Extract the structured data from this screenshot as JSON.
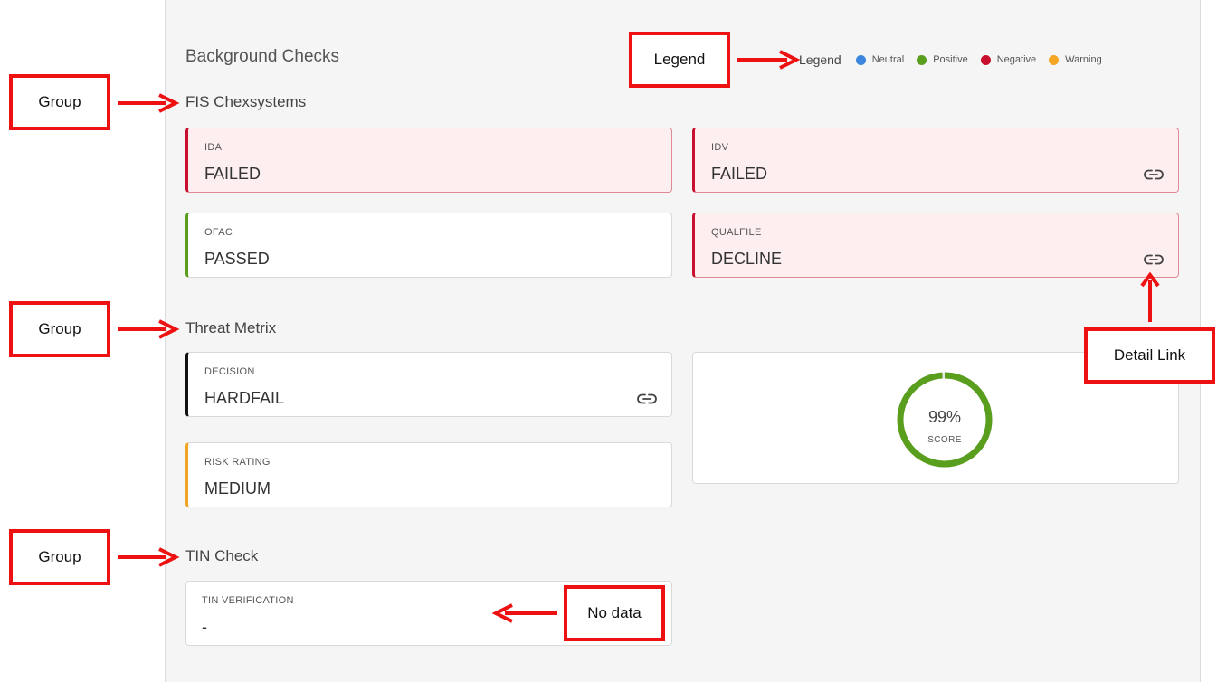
{
  "section": {
    "title": "Background Checks"
  },
  "legend": {
    "label": "Legend",
    "items": [
      {
        "label": "Neutral",
        "color": "#3d86e0"
      },
      {
        "label": "Positive",
        "color": "#5a9e1e"
      },
      {
        "label": "Negative",
        "color": "#c8102e"
      },
      {
        "label": "Warning",
        "color": "#f5a623"
      }
    ]
  },
  "groups": {
    "fis": {
      "title": "FIS Chexsystems",
      "ida": {
        "label": "IDA",
        "value": "FAILED",
        "status": "negative"
      },
      "idv": {
        "label": "IDV",
        "value": "FAILED",
        "status": "negative",
        "icon": "link-icon"
      },
      "ofac": {
        "label": "OFAC",
        "value": "PASSED",
        "status": "positive"
      },
      "qualfile": {
        "label": "QUALFILE",
        "value": "DECLINE",
        "status": "negative",
        "icon": "link-icon"
      }
    },
    "threat": {
      "title": "Threat Metrix",
      "decision": {
        "label": "DECISION",
        "value": "HARDFAIL",
        "icon": "link-icon"
      },
      "risk": {
        "label": "RISK RATING",
        "value": "MEDIUM",
        "status": "warning"
      },
      "score": {
        "value": "99%",
        "label": "SCORE",
        "percent": 99,
        "color": "#5a9e1e"
      }
    },
    "tin": {
      "title": "TIN Check",
      "verification": {
        "label": "TIN VERIFICATION",
        "value": "-"
      }
    }
  },
  "annotations": {
    "group": "Group",
    "legend": "Legend",
    "detail_link": "Detail Link",
    "no_data": "No data"
  }
}
